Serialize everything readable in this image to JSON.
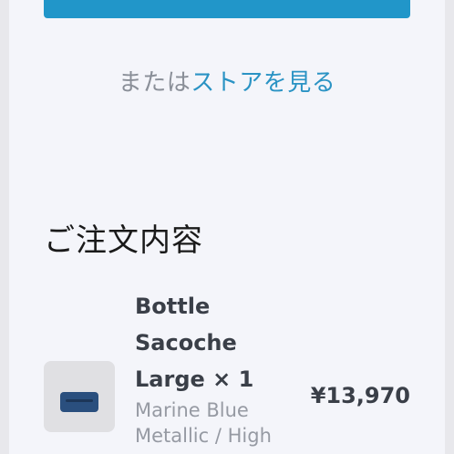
{
  "store_prompt": {
    "prefix": "または",
    "link": "ストアを見る"
  },
  "order_summary": {
    "title": "ご注文内容",
    "items": [
      {
        "name": "Bottle Sacoche Large",
        "quantity": "× 1",
        "variant": "Marine Blue Metallic / High",
        "price": "¥13,970"
      }
    ]
  },
  "colors": {
    "accent": "#2196c9",
    "link": "#2a93c4",
    "background": "#f4f5fa"
  }
}
